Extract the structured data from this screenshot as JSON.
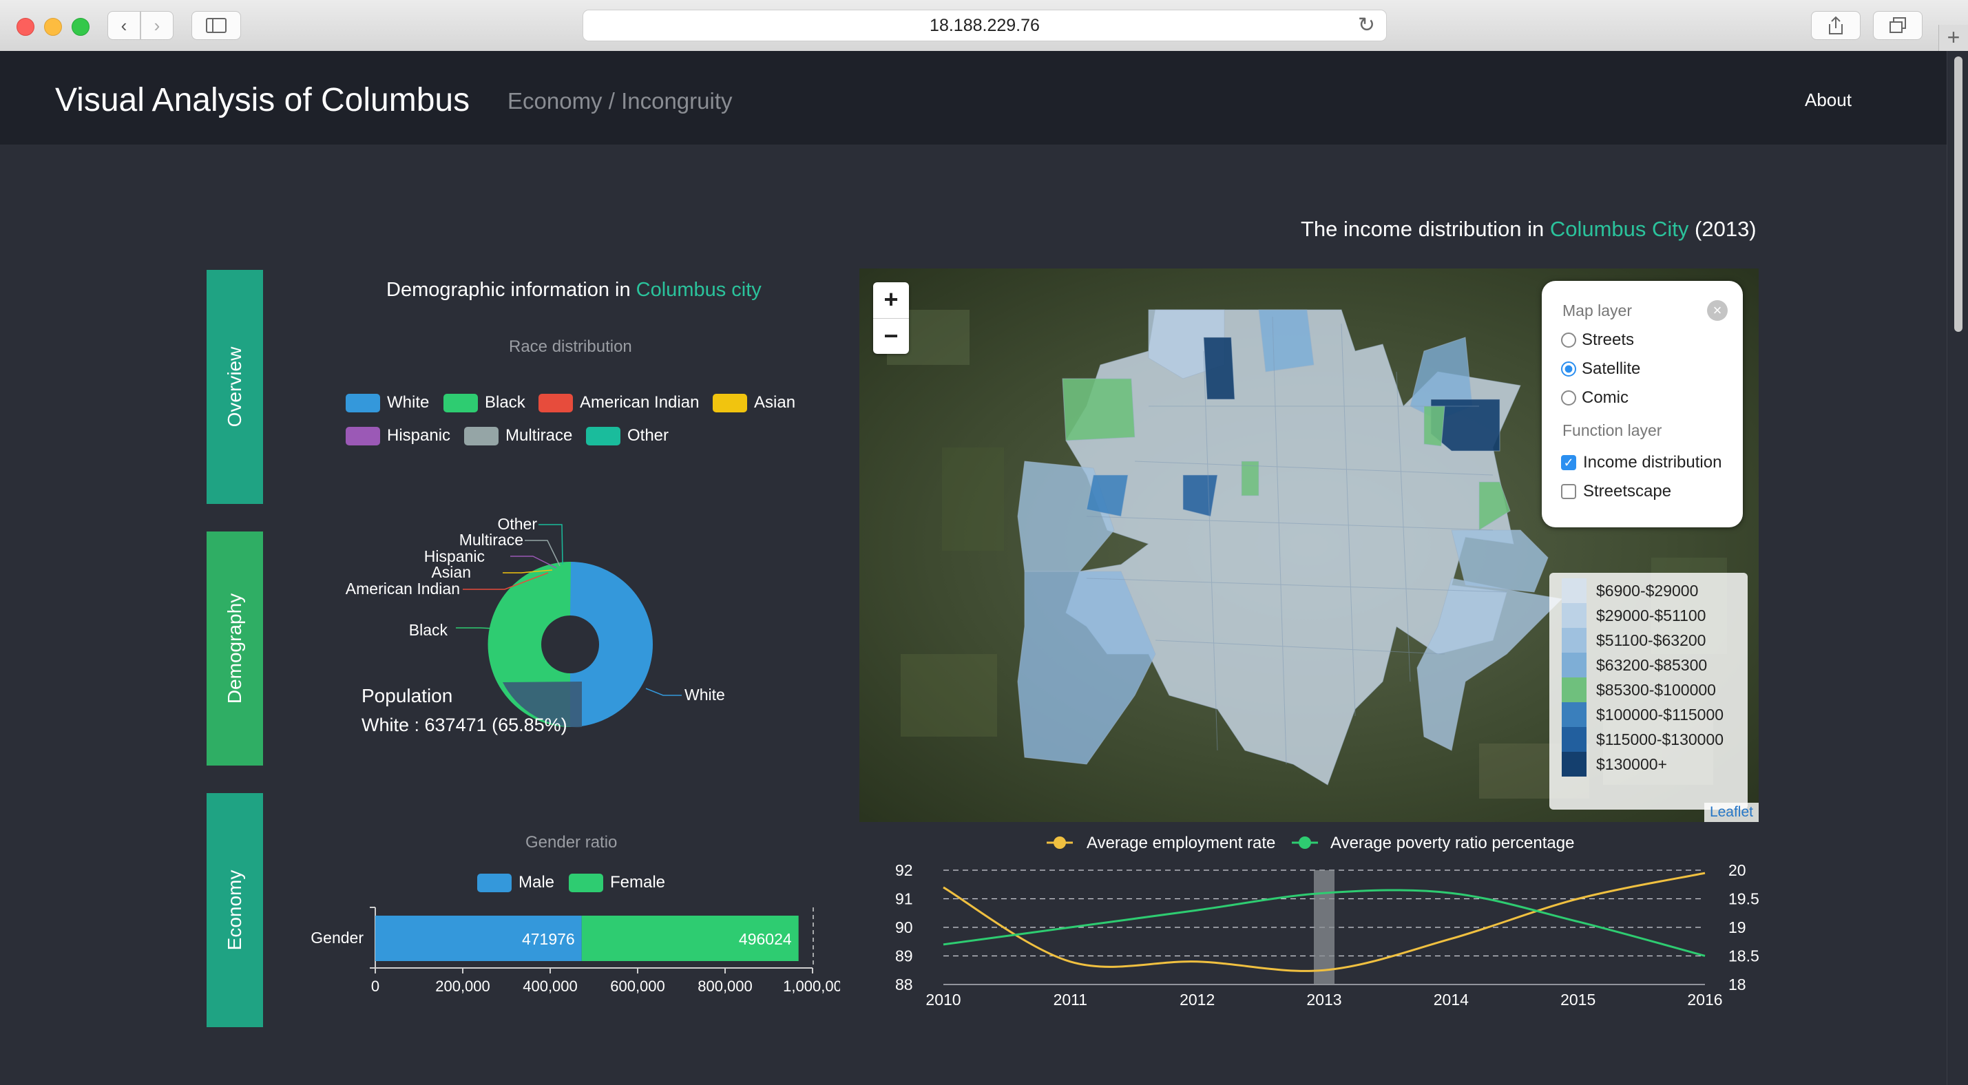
{
  "browser": {
    "url": "18.188.229.76"
  },
  "header": {
    "brand": "Visual Analysis of Columbus",
    "breadcrumb": "Economy / Incongruity",
    "about": "About"
  },
  "side_tabs": [
    "Overview",
    "Demography",
    "Economy"
  ],
  "demographic": {
    "title_prefix": "Demographic information in ",
    "title_highlight": "Columbus city",
    "race_title": "Race distribution",
    "legend": [
      {
        "label": "White",
        "color": "#3498db"
      },
      {
        "label": "Black",
        "color": "#2ecc71"
      },
      {
        "label": "American Indian",
        "color": "#e74c3c"
      },
      {
        "label": "Asian",
        "color": "#f1c40f"
      },
      {
        "label": "Hispanic",
        "color": "#9b59b6"
      },
      {
        "label": "Multirace",
        "color": "#95a5a6"
      },
      {
        "label": "Other",
        "color": "#1abc9c"
      }
    ],
    "pie_labels": [
      "Other",
      "Multirace",
      "Hispanic",
      "Asian",
      "American Indian",
      "Black",
      "White"
    ],
    "tooltip_title": "Population",
    "tooltip_value": "White : 637471 (65.85%)"
  },
  "gender": {
    "title": "Gender ratio",
    "legend": [
      {
        "label": "Male",
        "color": "#3498db"
      },
      {
        "label": "Female",
        "color": "#2ecc71"
      }
    ],
    "category": "Gender",
    "ticks": [
      "0",
      "200,000",
      "400,000",
      "600,000",
      "800,000",
      "1,000,00"
    ]
  },
  "map": {
    "title_prefix": "The income distribution in ",
    "title_highlight": "Columbus City",
    "title_suffix": " (2013)",
    "zoom_in": "+",
    "zoom_out": "−",
    "layer_control": {
      "map_layer_label": "Map layer",
      "base_layers": [
        {
          "label": "Streets",
          "selected": false
        },
        {
          "label": "Satellite",
          "selected": true
        },
        {
          "label": "Comic",
          "selected": false
        }
      ],
      "function_layer_label": "Function layer",
      "function_layers": [
        {
          "label": "Income distribution",
          "checked": true
        },
        {
          "label": "Streetscape",
          "checked": false
        }
      ]
    },
    "legend": [
      {
        "label": "$6900-$29000",
        "color": "#d6e1ec"
      },
      {
        "label": "$29000-$51100",
        "color": "#bcd2e6"
      },
      {
        "label": "$51100-$63200",
        "color": "#9fc1df"
      },
      {
        "label": "$63200-$85300",
        "color": "#7eaed6"
      },
      {
        "label": "$85300-$100000",
        "color": "#6fc07d"
      },
      {
        "label": "$100000-$115000",
        "color": "#3a7fbc"
      },
      {
        "label": "$115000-$130000",
        "color": "#225f9e"
      },
      {
        "label": "$130000+",
        "color": "#143f6e"
      }
    ],
    "attribution": "Leaflet"
  },
  "chart_data": [
    {
      "type": "pie",
      "title": "Race distribution",
      "categories": [
        "White",
        "Black",
        "American Indian",
        "Asian",
        "Hispanic",
        "Multirace",
        "Other"
      ],
      "values": [
        65.85,
        28.5,
        0.3,
        4.2,
        0.3,
        0.6,
        0.25
      ],
      "highlighted": "White"
    },
    {
      "type": "bar",
      "title": "Gender ratio",
      "orientation": "horizontal",
      "stacked": true,
      "categories": [
        "Gender"
      ],
      "series": [
        {
          "name": "Male",
          "values": [
            471976
          ]
        },
        {
          "name": "Female",
          "values": [
            496024
          ]
        }
      ],
      "xlim": [
        0,
        1000000
      ]
    },
    {
      "type": "line",
      "x": [
        2010,
        2011,
        2012,
        2013,
        2014,
        2015,
        2016
      ],
      "series": [
        {
          "name": "Average employment rate",
          "values": [
            91.4,
            88.8,
            88.8,
            88.5,
            89.6,
            91.0,
            91.9
          ],
          "color": "#f0c040",
          "axis": "left"
        },
        {
          "name": "Average poverty ratio percentage",
          "values": [
            18.7,
            19.0,
            19.3,
            19.6,
            19.6,
            19.1,
            18.5
          ],
          "color": "#2ecc71",
          "axis": "right"
        }
      ],
      "ylim_left": [
        88,
        92
      ],
      "ylim_right": [
        18,
        20
      ],
      "left_ticks": [
        "88",
        "89",
        "90",
        "91",
        "92"
      ],
      "right_ticks": [
        "18",
        "18.5",
        "19",
        "19.5",
        "20"
      ],
      "highlight_x": 2013
    }
  ]
}
